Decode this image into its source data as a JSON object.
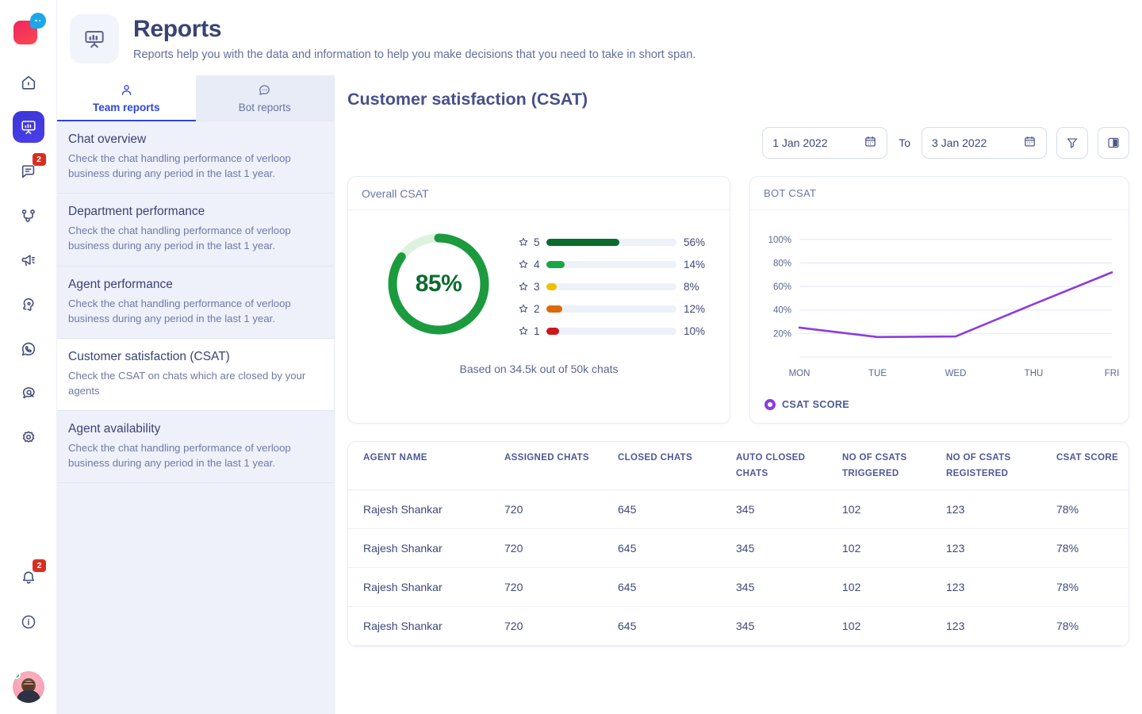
{
  "rail": {
    "logo_name": "verloop-logo",
    "items": [
      {
        "name": "home-icon",
        "badge": null,
        "active": false
      },
      {
        "name": "reports-icon",
        "badge": null,
        "active": true
      },
      {
        "name": "conversations-icon",
        "badge": "2",
        "active": false
      },
      {
        "name": "flow-builder-icon",
        "badge": null,
        "active": false
      },
      {
        "name": "campaign-icon",
        "badge": null,
        "active": false
      },
      {
        "name": "automation-icon",
        "badge": null,
        "active": false
      },
      {
        "name": "whatsapp-icon",
        "badge": null,
        "active": false
      },
      {
        "name": "search-chat-icon",
        "badge": null,
        "active": false
      },
      {
        "name": "settings-icon",
        "badge": null,
        "active": false
      }
    ],
    "bottom": [
      {
        "name": "notifications-bell-icon",
        "badge": "2"
      },
      {
        "name": "info-icon",
        "badge": null
      }
    ],
    "avatar_status": "online"
  },
  "header": {
    "icon": "presentation-chart-icon",
    "title": "Reports",
    "subtitle": "Reports help you with the data and information to help you make decisions that you need to take in short span."
  },
  "tabs": [
    {
      "label": "Team reports",
      "icon": "user-icon",
      "active": true
    },
    {
      "label": "Bot reports",
      "icon": "chat-bubble-icon",
      "active": false
    }
  ],
  "report_list": [
    {
      "title": "Chat overview",
      "desc": "Check the chat handling performance of verloop business during any period in the last 1 year.",
      "active": false
    },
    {
      "title": "Department performance",
      "desc": "Check the chat handling performance of verloop business during any period in the last 1 year.",
      "active": false
    },
    {
      "title": "Agent performance",
      "desc": "Check the chat handling performance of verloop business during any period in the last 1 year.",
      "active": false
    },
    {
      "title": "Customer satisfaction (CSAT)",
      "desc": "Check the CSAT on chats which are closed by your agents",
      "active": true
    },
    {
      "title": "Agent availability",
      "desc": "Check the chat handling performance of verloop business during any period in the last 1 year.",
      "active": false
    }
  ],
  "main": {
    "title": "Customer satisfaction (CSAT)",
    "date_from": "1 Jan 2022",
    "date_to": "3 Jan 2022",
    "to_label": "To",
    "filter_icon": "filter-funnel-icon",
    "columns_icon": "columns-layout-icon",
    "calendar_icon": "calendar-icon"
  },
  "overall_csat": {
    "card_title": "Overall CSAT",
    "score": "85%",
    "score_value": 85,
    "footnote": "Based on 34.5k out of 50k chats",
    "arc_color": "#1C9A3E",
    "arc_track_color": "#DDF3E0"
  },
  "bot_csat": {
    "card_title": "BOT CSAT",
    "legend_label": "CSAT SCORE",
    "line_color": "#8B3CE0"
  },
  "chart_data": [
    {
      "type": "bar",
      "title": "Overall CSAT rating breakdown",
      "orientation": "horizontal",
      "categories": [
        "5",
        "4",
        "3",
        "2",
        "1"
      ],
      "values": [
        56,
        14,
        8,
        12,
        10
      ],
      "value_labels": [
        "56%",
        "14%",
        "8%",
        "12%",
        "10%"
      ],
      "colors": [
        "#0A6B2D",
        "#18A845",
        "#F0C000",
        "#DA6A0A",
        "#CC1818"
      ],
      "xlabel": "",
      "ylabel": "Star rating",
      "xlim": [
        0,
        100
      ],
      "grid": false,
      "legend": "none"
    },
    {
      "type": "line",
      "title": "BOT CSAT",
      "x": [
        "MON",
        "TUE",
        "WED",
        "THU",
        "FRI"
      ],
      "series": [
        {
          "name": "CSAT SCORE",
          "values": [
            25,
            17,
            17.5,
            45,
            72
          ],
          "color": "#8B3CE0"
        }
      ],
      "xlabel": "",
      "ylabel": "",
      "ylim": [
        0,
        110
      ],
      "yticks": [
        20,
        40,
        60,
        80,
        100
      ],
      "ytick_labels": [
        "20%",
        "40%",
        "60%",
        "80%",
        "100%"
      ],
      "grid": true,
      "legend": "bottom-left"
    }
  ],
  "table": {
    "columns": [
      {
        "l1": "AGENT NAME",
        "l2": ""
      },
      {
        "l1": "ASSIGNED CHATS",
        "l2": ""
      },
      {
        "l1": "CLOSED CHATS",
        "l2": ""
      },
      {
        "l1": "AUTO CLOSED",
        "l2": "CHATS"
      },
      {
        "l1": "NO OF CSATS",
        "l2": "TRIGGERED"
      },
      {
        "l1": "NO OF CSATS",
        "l2": "REGISTERED"
      },
      {
        "l1": "CSAT SCORE",
        "l2": ""
      }
    ],
    "rows": [
      {
        "agent": "Rajesh Shankar",
        "assigned": "720",
        "closed": "645",
        "auto_closed": "345",
        "triggered": "102",
        "registered": "123",
        "score": "78%"
      },
      {
        "agent": "Rajesh Shankar",
        "assigned": "720",
        "closed": "645",
        "auto_closed": "345",
        "triggered": "102",
        "registered": "123",
        "score": "78%"
      },
      {
        "agent": "Rajesh Shankar",
        "assigned": "720",
        "closed": "645",
        "auto_closed": "345",
        "triggered": "102",
        "registered": "123",
        "score": "78%"
      },
      {
        "agent": "Rajesh Shankar",
        "assigned": "720",
        "closed": "645",
        "auto_closed": "345",
        "triggered": "102",
        "registered": "123",
        "score": "78%"
      }
    ]
  }
}
